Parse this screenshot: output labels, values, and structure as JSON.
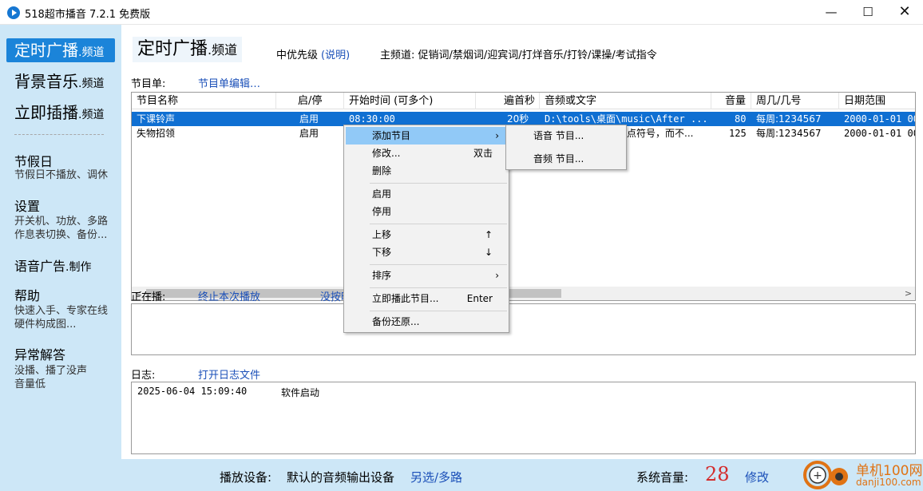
{
  "window": {
    "title": "518超市播音 7.2.1 免费版",
    "min": "—",
    "max": "☐",
    "close": "✕"
  },
  "sidebar": {
    "channels": [
      {
        "main": "定时广播",
        "suffix": ".频道"
      },
      {
        "main": "背景音乐",
        "suffix": ".频道"
      },
      {
        "main": "立即插播",
        "suffix": ".频道"
      }
    ],
    "sections": [
      {
        "title": "节假日",
        "sub": "节假日不播放、调休"
      },
      {
        "title": "设置",
        "sub": "开关机、功放、多路\n作息表切换、备份..."
      },
      {
        "title": "语音广告",
        "title_suffix": ".制作",
        "sub": ""
      },
      {
        "title": "帮助",
        "sub": "快速入手、专家在线\n硬件构成图..."
      },
      {
        "title": "异常解答",
        "sub": "没播、播了没声\n音量低"
      }
    ]
  },
  "header": {
    "title": "定时广播",
    "title_suffix": ".频道",
    "priority_label": "中优先级",
    "explain_link": "(说明)",
    "main_channel": "主频道:  促销词/禁烟词/迎宾词/打烊音乐/打铃/课操/考试指令"
  },
  "program_list": {
    "label": "节目单:",
    "edit_link": "节目单编辑…",
    "columns": [
      "节目名称",
      "启/停",
      "开始时间 (可多个)",
      "遍首秒",
      "音频或文字",
      "音量",
      "周几/几号",
      "日期范围"
    ],
    "rows": [
      {
        "name": "下课铃声",
        "state": "启用",
        "start": "08:30:00",
        "seconds": "20秒",
        "audio": "D:\\tools\\桌面\\music\\After ...",
        "volume": "80",
        "weekday": "每周:1234567",
        "range": "2000-01-01 00"
      },
      {
        "name": "失物招领",
        "state": "启用",
        "start": "",
        "seconds": "",
        "audio": "点符号，而不...",
        "volume": "125",
        "weekday": "每周:1234567",
        "range": "2000-01-01 00"
      }
    ]
  },
  "now_playing": {
    "label": "正在播:",
    "stop_link": "终止本次播放",
    "partial_link": "没按时"
  },
  "log": {
    "label": "日志:",
    "open_link": "打开日志文件",
    "entries": [
      {
        "time": "2025-06-04 15:09:40",
        "msg": "软件启动"
      }
    ]
  },
  "context_menu": {
    "items": [
      {
        "label": "添加节目",
        "shortcut": "",
        "submenu": true
      },
      {
        "label": "修改...",
        "shortcut": "双击"
      },
      {
        "label": "删除",
        "shortcut": ""
      },
      {
        "label": "启用",
        "shortcut": ""
      },
      {
        "label": "停用",
        "shortcut": ""
      },
      {
        "label": "上移",
        "shortcut": "↑"
      },
      {
        "label": "下移",
        "shortcut": "↓"
      },
      {
        "label": "排序",
        "shortcut": "",
        "submenu": true
      },
      {
        "label": "立即播此节目...",
        "shortcut": "Enter"
      },
      {
        "label": "备份还原...",
        "shortcut": ""
      }
    ],
    "submenu": [
      "语音 节目...",
      "音频 节目..."
    ]
  },
  "footer": {
    "device_label": "播放设备:",
    "device_value": "默认的音频输出设备",
    "device_link": "另选/多路",
    "volume_label": "系统音量:",
    "volume_value": "28",
    "volume_link": "修改"
  },
  "watermark": {
    "title": "单机100网",
    "url": "danji100.com"
  },
  "colors": {
    "sidebar_bg": "#cde7f7",
    "active_nav": "#1b84d9",
    "selected_row": "#0f6fd2",
    "link": "#1a4fb8",
    "volume_number": "#d42c2c",
    "menu_highlight": "#91c9f7"
  }
}
